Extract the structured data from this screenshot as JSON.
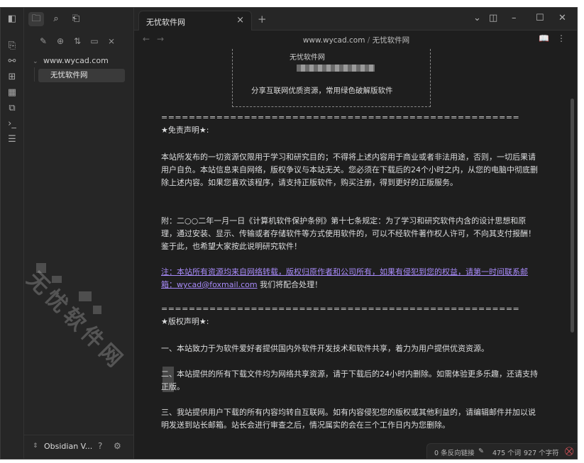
{
  "tab": {
    "title": "无忧软件网",
    "close": "×",
    "new": "+"
  },
  "window_controls": {
    "dropdown": "⌄",
    "sidebar_toggle": "◫",
    "minimize": "–",
    "maximize": "☐",
    "close": "✕"
  },
  "breadcrumb": {
    "folder": "www.wycad.com",
    "separator": "/",
    "file": "无忧软件网"
  },
  "nav": {
    "back": "←",
    "forward": "→",
    "reading_view": "📖",
    "more": "⋮"
  },
  "file_tree": {
    "folder": "www.wycad.com",
    "file": "无忧软件网"
  },
  "vault": {
    "name": "Obsidian V...",
    "help": "?",
    "settings": "⚙"
  },
  "banner": {
    "line1": "无忧软件网",
    "line3": "分享互联网优质资源，常用绿色破解版软件"
  },
  "document": {
    "divider": "====================================================",
    "disclaimer_heading": "★免责声明★:",
    "para1": "本站所发布的一切资源仅限用于学习和研究目的；不得将上述内容用于商业或者非法用途，否则，一切后果请用户自负。本站信息来自网络，版权争议与本站无关。您必须在下载后的24个小时之内，从您的电脑中彻底删除上述内容。如果您喜欢该程序，请支持正版软件，购买注册，得到更好的正版服务。",
    "para2": "附：二○○二年一月一日《计算机软件保护条例》第十七条规定：为了学习和研究软件内含的设计思想和原理，通过安装、显示、传输或者存储软件等方式使用软件的，可以不经软件著作权人许可，不向其支付报酬！鉴于此，也希望大家按此说明研究软件！",
    "link_text": "注：本站所有资源均来自网络转载，版权归原作者和公司所有，如果有侵犯到您的权益，请第一时间联系邮箱：wycad@foxmail.com",
    "after_link": " 我们将配合处理！",
    "copyright_heading": "★版权声明★:",
    "item1": "一、本站致力于为软件爱好者提供国内外软件开发技术和软件共享，着力为用户提供优资资源。",
    "item2": "二、本站提供的所有下载文件均为网络共享资源，请于下载后的24小时内删除。如需体验更多乐趣，还请支持正版。",
    "item3": "三、我站提供用户下载的所有内容均转自互联网。如有内容侵犯您的版权或其他利益的，请编辑邮件并加以说明发送到站长邮箱。站长会进行审查之后，情况属实的会在三个工作日内为您删除。"
  },
  "watermark": "无忧软件网",
  "status": {
    "backlinks": "0 条反向链接",
    "words": "475 个词",
    "chars": "927 个字符"
  },
  "colors": {
    "background": "#1e1e1e",
    "panel": "#262626",
    "link": "#a88bfa",
    "sync_error": "#e0535a"
  }
}
